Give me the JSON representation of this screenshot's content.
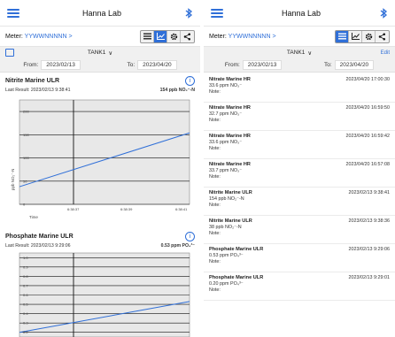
{
  "left": {
    "app_title": "Hanna Lab",
    "meter_label": "Meter:",
    "meter_id": "YYWWNNNNN >",
    "tank": "TANK1",
    "from_label": "From:",
    "from_date": "2023/02/13",
    "to_label": "To:",
    "to_date": "2023/04/20",
    "charts": [
      {
        "title": "Nitrite Marine ULR",
        "last_result": "Last Result: 2023/02/13 9:38:41",
        "last_value": "154 ppb NO₂⁻-N",
        "ylabel": "ppb NO₂⁻-N",
        "xlabel": "Time",
        "ytick_labels": [
          "200",
          "150",
          "100",
          "50",
          "0"
        ],
        "xtick_labels": [
          "6:38:37",
          "6:38:39",
          "6:38:41"
        ]
      },
      {
        "title": "Phosphate Marine ULR",
        "last_result": "Last Result: 2023/02/13 9:29:06",
        "last_value": "0.53 ppm PO₄³⁻",
        "ytick_labels": [
          "1.0",
          "0.9",
          "0.8",
          "0.7",
          "0.6",
          "0.5",
          "0.4",
          "0.3",
          "0.2"
        ]
      }
    ]
  },
  "right": {
    "app_title": "Hanna Lab",
    "meter_label": "Meter:",
    "meter_id": "YYWWNNNNN >",
    "tank": "TANK1",
    "edit": "Edit",
    "from_label": "From:",
    "from_date": "2023/02/13",
    "to_label": "To:",
    "to_date": "2023/04/20",
    "entries": [
      {
        "name": "Nitrate Marine HR",
        "value": "33.6 ppm NO₃⁻",
        "note": "Note:",
        "time": "2023/04/20 17:00:30"
      },
      {
        "name": "Nitrate Marine HR",
        "value": "32.7 ppm NO₃⁻",
        "note": "Note:",
        "time": "2023/04/20 16:59:50"
      },
      {
        "name": "Nitrate Marine HR",
        "value": "33.6 ppm NO₃⁻",
        "note": "Note:",
        "time": "2023/04/20 16:59:42"
      },
      {
        "name": "Nitrate Marine HR",
        "value": "33.7 ppm NO₃⁻",
        "note": "Note:",
        "time": "2023/04/20 16:57:08"
      },
      {
        "name": "Nitrite Marine ULR",
        "value": "154 ppb NO₂⁻-N",
        "note": "Note:",
        "time": "2023/02/13 9:38:41"
      },
      {
        "name": "Nitrite Marine ULR",
        "value": "38 ppb NO₂⁻-N",
        "note": "Note:",
        "time": "2023/02/13 9:38:36"
      },
      {
        "name": "Phosphate Marine ULR",
        "value": "0.53 ppm PO₄³⁻",
        "note": "Note:",
        "time": "2023/02/13 9:29:06"
      },
      {
        "name": "Phosphate Marine ULR",
        "value": "0.20 ppm PO₄³⁻",
        "note": "Note:",
        "time": "2023/02/13 9:29:01"
      }
    ]
  },
  "chart_data": [
    {
      "type": "line",
      "title": "Nitrite Marine ULR",
      "xlabel": "Time",
      "ylabel": "ppb NO₂⁻-N",
      "ylim": [
        0,
        225
      ],
      "x": [
        "6:38:37",
        "6:38:39",
        "6:38:41"
      ],
      "series": [
        {
          "values": [
            38,
            96,
            154
          ]
        }
      ],
      "grid": true
    },
    {
      "type": "line",
      "title": "Phosphate Marine ULR",
      "ylim": [
        0.15,
        1.05
      ],
      "series": [
        {
          "values": [
            0.2,
            0.53
          ]
        }
      ],
      "grid": true
    }
  ],
  "colors": {
    "accent": "#2f6fd8",
    "line": "#2f6fd8",
    "plot_bg": "#e8e8e8"
  }
}
